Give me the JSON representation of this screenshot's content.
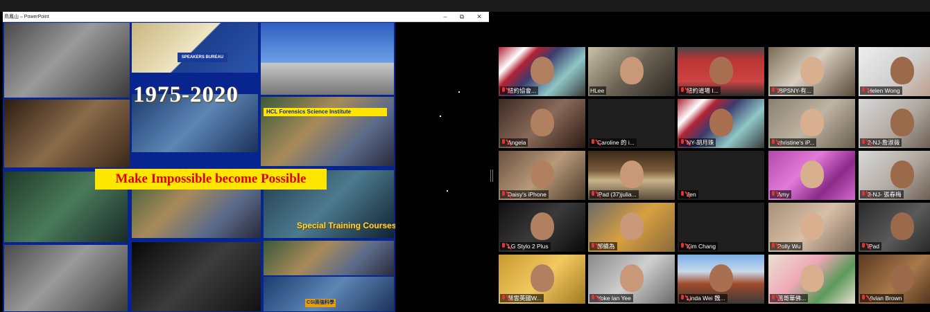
{
  "window": {
    "title": "鳥鳳山 – PowerPoint",
    "minimize_icon": "–",
    "maximize_icon": "⧉",
    "close_icon": "✕"
  },
  "slide": {
    "years": "1975-2020",
    "speakers_bureau": "SPEAKERS BUREAU",
    "forensics_label": "HCL Forensics Science Institute",
    "banner": "Make Impossible become Possible",
    "special_training": "Special Training Courses",
    "csi_label": "CSI高強科學"
  },
  "participants": [
    {
      "name": "紐約協會...",
      "muted": true,
      "active": false,
      "bg": "flag"
    },
    {
      "name": "HLee",
      "muted": false,
      "active": true,
      "bg": "room"
    },
    {
      "name": "紐約道場 I...",
      "muted": true,
      "active": false,
      "bg": "building"
    },
    {
      "name": "IBPSNY-有...",
      "muted": true,
      "active": false,
      "bg": "calligraphy"
    },
    {
      "name": "Helen Wong",
      "muted": true,
      "active": false,
      "bg": "bright"
    },
    {
      "name": "Angela",
      "muted": true,
      "active": false,
      "bg": "room2"
    },
    {
      "name": "Caroline 的 i...",
      "muted": true,
      "active": false,
      "bg": "none"
    },
    {
      "name": "NY-胡月珠",
      "muted": true,
      "active": false,
      "bg": "flag"
    },
    {
      "name": "christine's iP...",
      "muted": true,
      "active": false,
      "bg": "blur"
    },
    {
      "name": "2-NJ-詹淑薇",
      "muted": true,
      "active": false,
      "bg": "plain"
    },
    {
      "name": "Daisy's iPhone",
      "muted": true,
      "active": false,
      "bg": "warm"
    },
    {
      "name": "iPad (37)julia...",
      "muted": true,
      "active": false,
      "bg": "kitchen"
    },
    {
      "name": "Jen",
      "muted": true,
      "active": false,
      "bg": "none"
    },
    {
      "name": "Amy",
      "muted": true,
      "active": false,
      "bg": "flowers"
    },
    {
      "name": "3-NJ- 張春梅",
      "muted": true,
      "active": false,
      "bg": "plain"
    },
    {
      "name": "LG Stylo 2 Plus",
      "muted": true,
      "active": false,
      "bg": "dark"
    },
    {
      "name": "郝績為",
      "muted": true,
      "active": false,
      "bg": "couple"
    },
    {
      "name": "Kim Chang",
      "muted": true,
      "active": false,
      "bg": "none"
    },
    {
      "name": "Polly Wu",
      "muted": true,
      "active": false,
      "bg": "closeup"
    },
    {
      "name": "iPad",
      "muted": true,
      "active": false,
      "bg": "dim"
    },
    {
      "name": "慧雲英國W...",
      "muted": true,
      "active": false,
      "bg": "yellow"
    },
    {
      "name": "Yoke lan Yee",
      "muted": true,
      "active": false,
      "bg": "room3"
    },
    {
      "name": "Linda Wei 魏...",
      "muted": true,
      "active": false,
      "bg": "gate"
    },
    {
      "name": "溫哥華佛...",
      "muted": true,
      "active": false,
      "bg": "lotus"
    },
    {
      "name": "Vivian Brown",
      "muted": true,
      "active": false,
      "bg": "wood"
    }
  ],
  "colors": {
    "active_speaker": "#c6d62a",
    "muted_mic": "#e23434",
    "slide_bg": "#08248f",
    "banner_bg": "#ffe600",
    "banner_text": "#e00000"
  }
}
